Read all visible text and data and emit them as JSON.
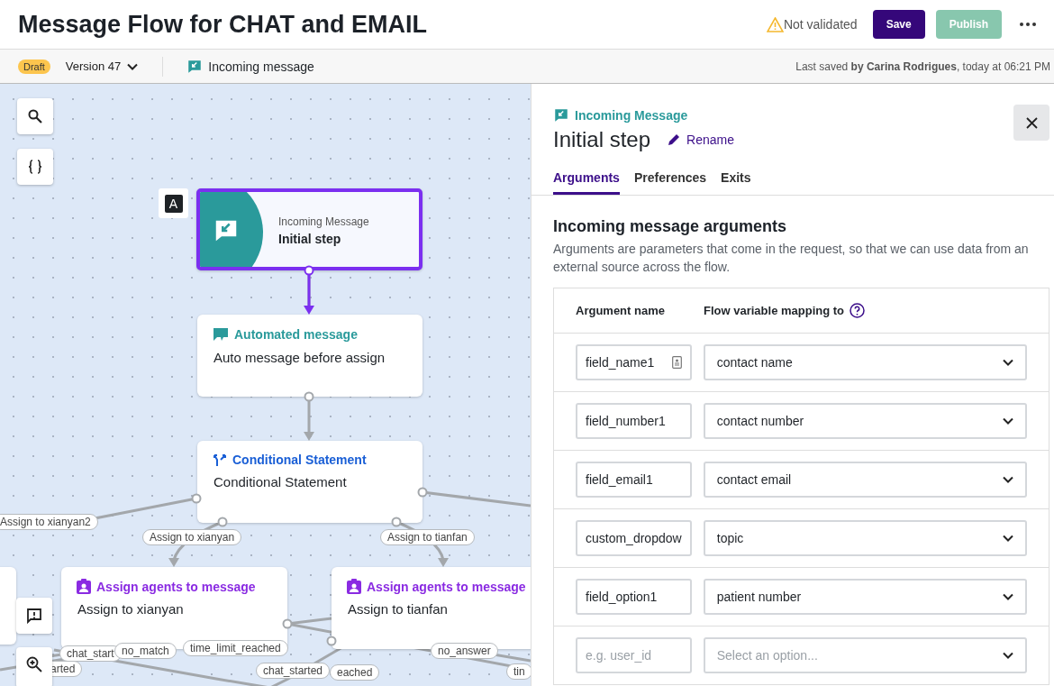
{
  "header": {
    "title": "Message Flow for CHAT and EMAIL",
    "validation": "Not validated",
    "buttons": [
      {
        "label": "Save",
        "kind": "primary",
        "disabled": false
      },
      {
        "label": "Publish",
        "kind": "publish",
        "disabled": true
      }
    ]
  },
  "subbar": {
    "status_badge": "Draft",
    "version": "Version 47",
    "trigger": "Incoming message",
    "last_saved": "Last saved **by Carina Rodrigues**, today at 06:21 PM"
  },
  "canvas": {
    "start_marker": "A",
    "nodes": [
      {
        "kind": "trigger",
        "type": "Incoming Message",
        "title": "Initial step",
        "selected": true
      },
      {
        "kind": "message",
        "type": "Automated message",
        "title": "Auto message before assign",
        "selected": false
      },
      {
        "kind": "condition",
        "type": "Conditional Statement",
        "title": "Conditional Statement",
        "selected": false
      },
      {
        "kind": "assign",
        "type": "Assign agents to message",
        "title": "Assign to xianyan",
        "selected": false
      },
      {
        "kind": "assign",
        "type": "Assign agents to message",
        "title": "Assign to tianfan",
        "selected": false
      }
    ],
    "edge_labels": [
      "Assign to xianyan2",
      "Assign to xianyan",
      "Assign to tianfan",
      "chat_start",
      "no_match",
      "time_limit_reached",
      "arted",
      "chat_started",
      "eached",
      "no_answer",
      "tin"
    ]
  },
  "panel": {
    "node_type": "Incoming Message",
    "node_name": "Initial step",
    "rename": "Rename",
    "tabs": [
      {
        "label": "Arguments",
        "selected": true
      },
      {
        "label": "Preferences",
        "selected": false
      },
      {
        "label": "Exits",
        "selected": false
      }
    ],
    "section_title": "Incoming message arguments",
    "description": "Arguments are parameters that come in the request, so that we can use data from an external source across the flow.",
    "columns": [
      "Argument name",
      "Flow variable mapping to"
    ],
    "rows": [
      {
        "argument": "field_name1",
        "mapping": "contact name",
        "autofill_icon": true
      },
      {
        "argument": "field_number1",
        "mapping": "contact number",
        "autofill_icon": false
      },
      {
        "argument": "field_email1",
        "mapping": "contact email",
        "autofill_icon": false
      },
      {
        "argument": "custom_dropdow",
        "mapping": "topic",
        "autofill_icon": false
      },
      {
        "argument": "field_option1",
        "mapping": "patient number",
        "autofill_icon": false
      }
    ],
    "new_row": {
      "argument_placeholder": "e.g. user_id",
      "mapping_placeholder": "Select an option..."
    }
  }
}
